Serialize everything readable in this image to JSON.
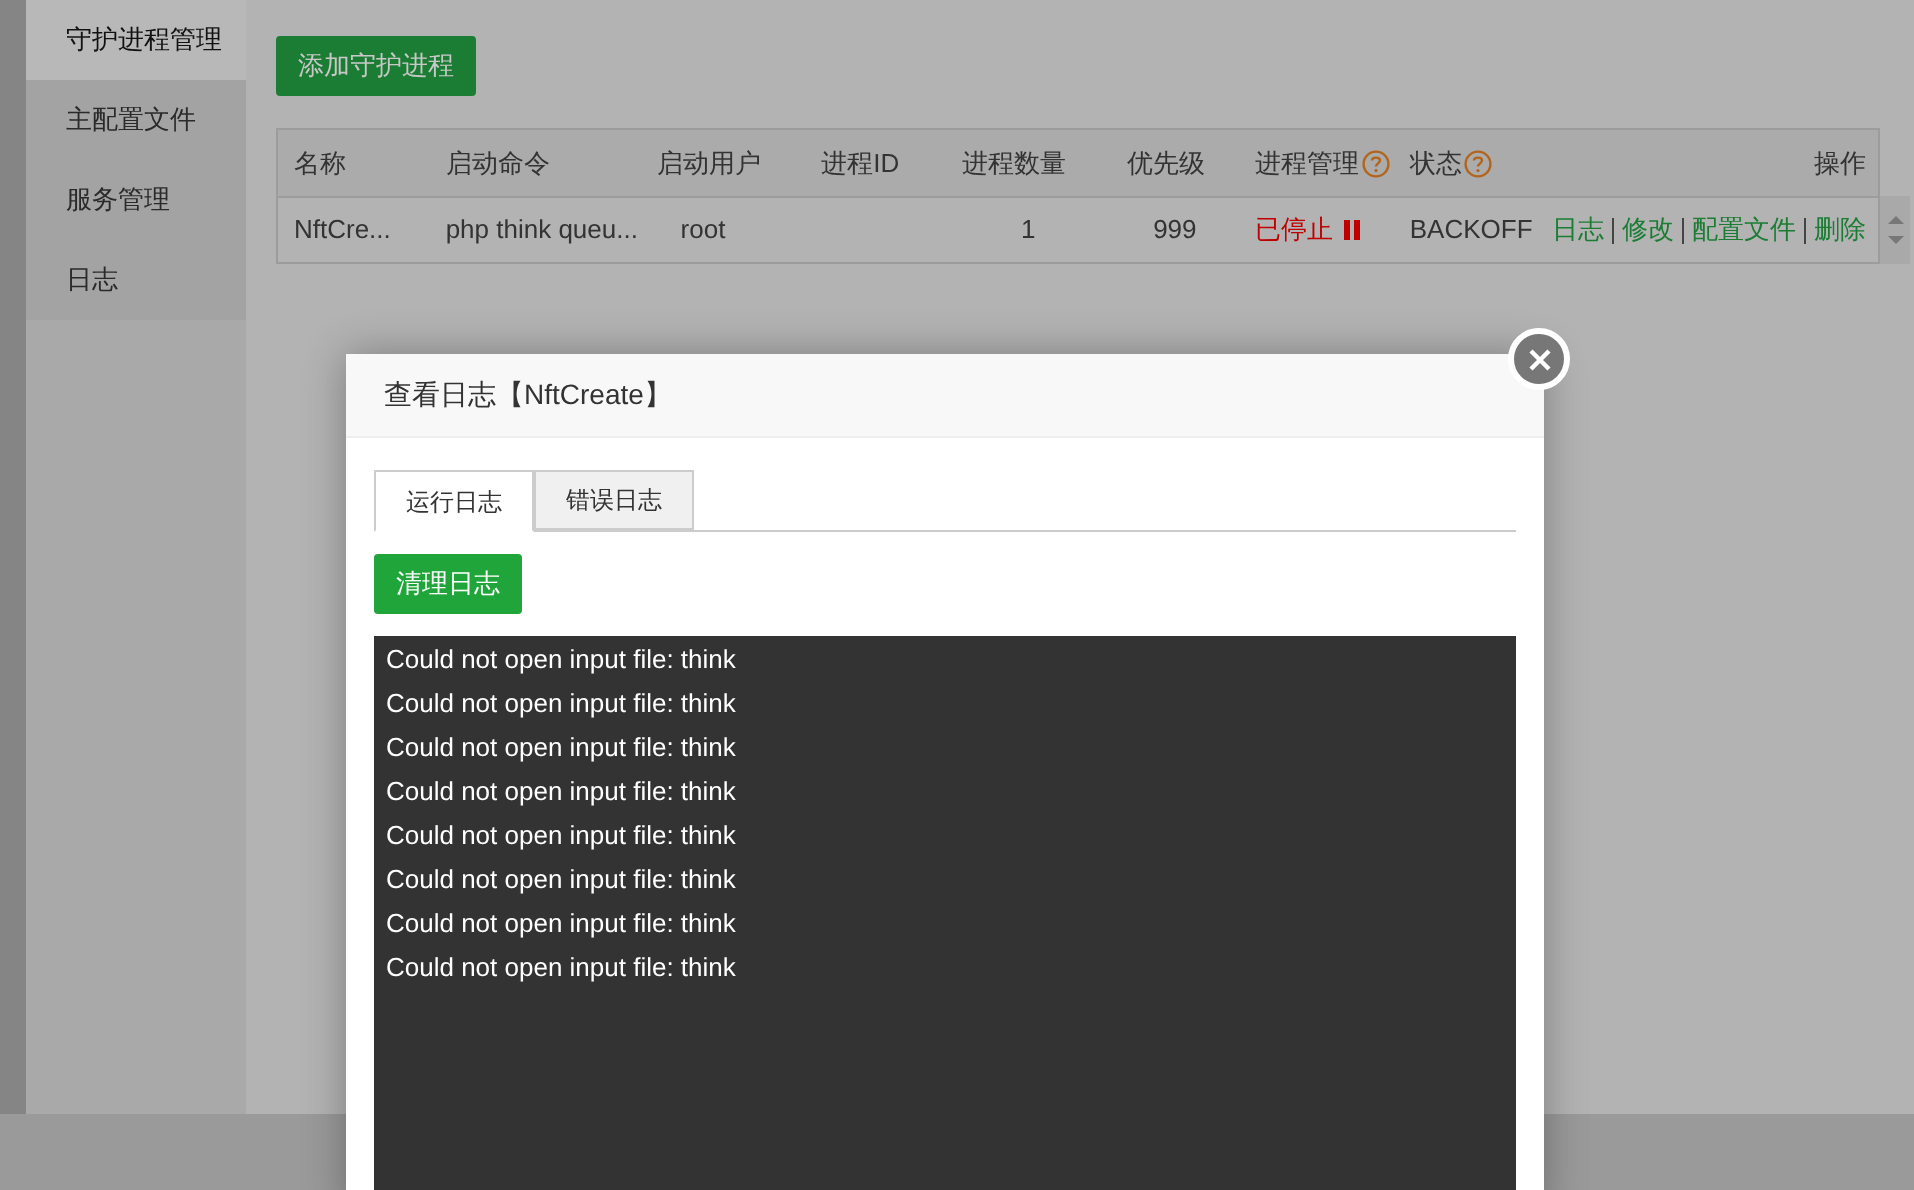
{
  "sidebar": {
    "items": [
      {
        "label": "守护进程管理",
        "selected": true
      },
      {
        "label": "主配置文件",
        "selected": false
      },
      {
        "label": "服务管理",
        "selected": false
      },
      {
        "label": "日志",
        "selected": false
      }
    ]
  },
  "add_button": "添加守护进程",
  "table": {
    "columns": [
      {
        "label": "名称",
        "help": false
      },
      {
        "label": "启动命令",
        "help": false
      },
      {
        "label": "启动用户",
        "help": false
      },
      {
        "label": "进程ID",
        "help": false
      },
      {
        "label": "进程数量",
        "help": false
      },
      {
        "label": "优先级",
        "help": false
      },
      {
        "label": "进程管理",
        "help": true
      },
      {
        "label": "状态",
        "help": true
      },
      {
        "label": "操作",
        "help": false
      }
    ],
    "rows": [
      {
        "name": "NftCre...",
        "command": "php think queu...",
        "user": "root",
        "pid": "",
        "count": "1",
        "priority": "999",
        "process": {
          "label": "已停止",
          "running": false
        },
        "status": "BACKOFF",
        "actions": [
          "日志",
          "修改",
          "配置文件",
          "删除"
        ]
      }
    ]
  },
  "dialog": {
    "title": "查看日志【NftCreate】",
    "tabs": [
      {
        "label": "运行日志",
        "selected": true
      },
      {
        "label": "错误日志",
        "selected": false
      }
    ],
    "clear_button": "清理日志",
    "log_lines": [
      "Could not open input file: think",
      "Could not open input file: think",
      "Could not open input file: think",
      "Could not open input file: think",
      "Could not open input file: think",
      "Could not open input file: think",
      "Could not open input file: think",
      "Could not open input file: think"
    ]
  }
}
